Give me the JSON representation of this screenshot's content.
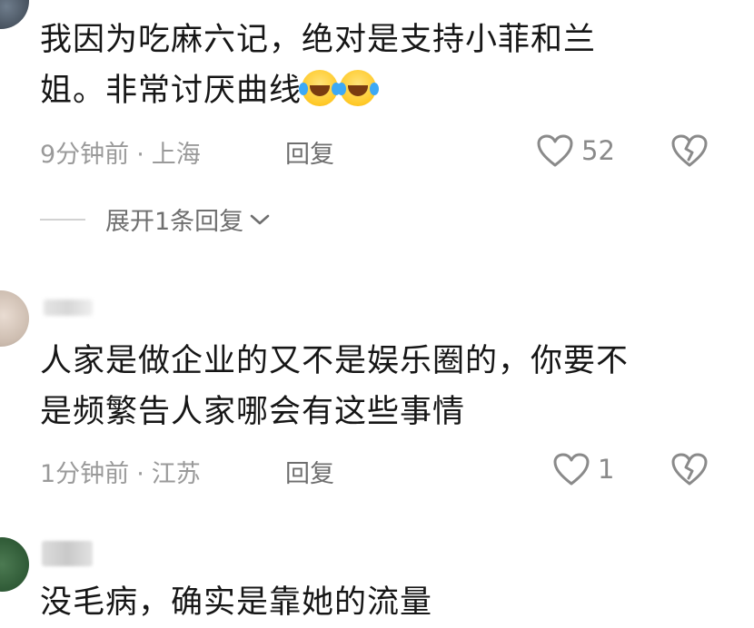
{
  "comments": [
    {
      "text_lines": [
        "我因为吃麻六记，绝对是支持小菲和兰",
        "姐。非常讨厌曲线"
      ],
      "emojis": [
        "laughing-crying-emoji",
        "laughing-crying-emoji"
      ],
      "time": "9分钟前",
      "separator": "·",
      "location": "上海",
      "reply_label": "回复",
      "likes": "52",
      "expand_label": "展开1条回复"
    },
    {
      "text_lines": [
        "人家是做企业的又不是娱乐圈的，你要不",
        "是频繁告人家哪会有这些事情"
      ],
      "time": "1分钟前",
      "separator": "·",
      "location": "江苏",
      "reply_label": "回复",
      "likes": "1"
    },
    {
      "text_lines": [
        "没毛病，确实是靠她的流量"
      ]
    }
  ],
  "icons": {
    "like": "heart-outline-icon",
    "dislike": "broken-heart-icon",
    "expand": "chevron-down-icon"
  },
  "colors": {
    "text": "#161616",
    "meta": "#9a9a9a",
    "reply": "#6e6e6e",
    "icon": "#8a8a8a"
  }
}
